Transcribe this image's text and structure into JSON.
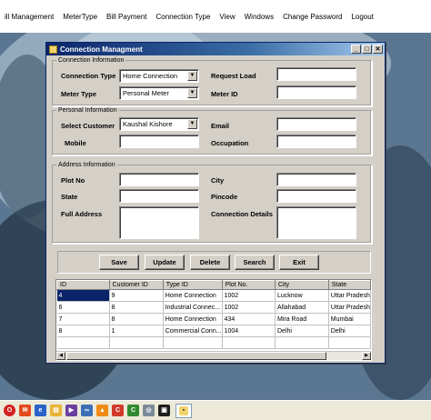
{
  "menubar": {
    "items": [
      "ill Management",
      "MeterType",
      "Bill Payment",
      "Connection Type",
      "View",
      "Windows",
      "Change Password",
      "Logout"
    ]
  },
  "window": {
    "title": "Connection Managment",
    "buttons": {
      "minimize": "_",
      "maximize": "□",
      "close": "✕"
    }
  },
  "connection_info": {
    "legend": "Connection Information",
    "connection_type_label": "Connection Type",
    "connection_type_value": "Home Connection",
    "meter_type_label": "Meter Type",
    "meter_type_value": "Personal Meter",
    "request_load_label": "Request Load",
    "request_load_value": "",
    "meter_id_label": "Meter ID",
    "meter_id_value": ""
  },
  "personal_info": {
    "legend": "Personal Information",
    "select_customer_label": "Select Customer",
    "select_customer_value": "Kaushal Kishore",
    "mobile_label": "Mobile",
    "mobile_value": "",
    "email_label": "Email",
    "email_value": "",
    "occupation_label": "Occupation",
    "occupation_value": ""
  },
  "address_info": {
    "legend": "Address Information",
    "plot_no_label": "Plot No",
    "plot_no_value": "",
    "state_label": "State",
    "state_value": "",
    "full_address_label": "Full Address",
    "full_address_value": "",
    "city_label": "City",
    "city_value": "",
    "pincode_label": "Pincode",
    "pincode_value": "",
    "connection_details_label": "Connection Details",
    "connection_details_value": ""
  },
  "actions": {
    "save": "Save",
    "update": "Update",
    "delete": "Delete",
    "search": "Search",
    "exit": "Exit"
  },
  "grid": {
    "columns": [
      "ID",
      "Customer ID",
      "Type ID",
      "Plot No.",
      "City",
      "State"
    ],
    "rows": [
      [
        "4",
        "9",
        "Home Connection",
        "1002",
        "Lucknow",
        "Uttar Pradesh"
      ],
      [
        "6",
        "8",
        "Industrial Connec...",
        "1002",
        "Allahabad",
        "Uttar Pradesh"
      ],
      [
        "7",
        "8",
        "Home Connection",
        "434",
        "Mira Road",
        "Mumbai"
      ],
      [
        "8",
        "1",
        "Commercial Conn...",
        "1004",
        "Delhi",
        "Delhi"
      ]
    ],
    "selected_cell": {
      "row": 0,
      "column": 0
    }
  },
  "taskbar": {
    "icons": [
      "opera-icon",
      "outlook-icon",
      "explorer-icon",
      "folder-icon",
      "visual-studio-icon",
      "link-icon",
      "vlc-icon",
      "ccleaner-icon",
      "camtasia-icon",
      "disk-icon",
      "cmd-icon",
      "active-window-icon"
    ]
  }
}
